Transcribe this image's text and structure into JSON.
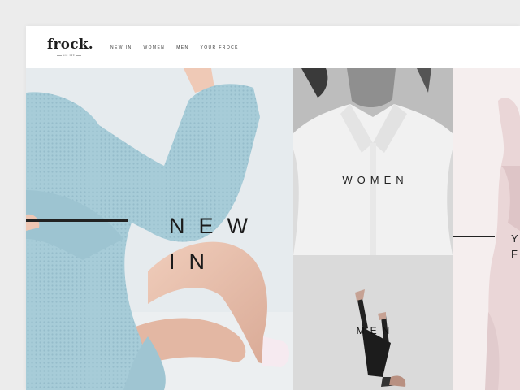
{
  "brand": {
    "logo": "frock.",
    "tagline": "est 199"
  },
  "nav": {
    "items": [
      "NEW IN",
      "WOMEN",
      "MEN",
      "YOUR FROCK"
    ]
  },
  "tiles": {
    "new_in": "NEW\nIN",
    "women": "WOMEN",
    "men": "MEN",
    "your_frock": "Y\nF"
  },
  "colors": {
    "background": "#ececec",
    "header": "#ffffff",
    "text": "#1b1b1b",
    "garment_blue": "#a9cdd8",
    "garment_pink": "#ead5d6"
  }
}
